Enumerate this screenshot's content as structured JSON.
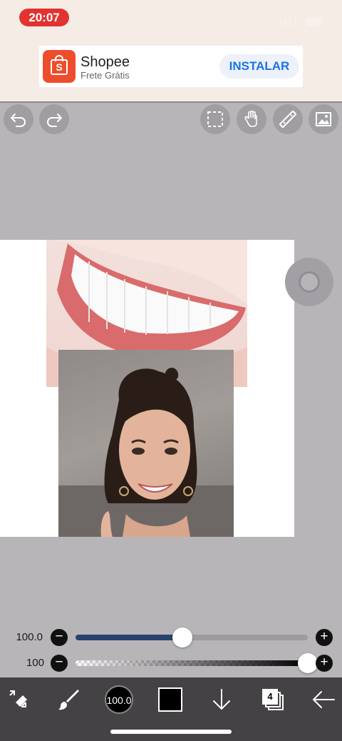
{
  "status_bar": {
    "time": "20:07"
  },
  "ad": {
    "brand_icon": "shopee-bag-icon",
    "title": "Shopee",
    "subtitle": "Frete Grátis",
    "install_label": "INSTALAR",
    "brand_color": "#ee4d2d"
  },
  "toolbar": {
    "icons": [
      "undo-icon",
      "redo-icon",
      "selection-icon",
      "hand-move-icon",
      "ruler-icon",
      "image-icon"
    ]
  },
  "sliders": {
    "size": {
      "label": "100.0",
      "fraction": 0.459
    },
    "opacity": {
      "label": "100",
      "fraction": 1.0
    },
    "minus": "−",
    "plus": "+"
  },
  "bottom_bar": {
    "brush_size": "100.0",
    "layer_count": "4",
    "icons": [
      "transform-eraser-icon",
      "brush-icon",
      "brush-size-icon",
      "color-icon",
      "download-icon",
      "layers-icon",
      "back-arrow-icon"
    ],
    "current_color": "#000000"
  },
  "colors": {
    "accent": "#26446e",
    "toolbar_bg": "#444244",
    "workspace_bg": "#b8b5b9",
    "status_pill": "#e1332f"
  }
}
